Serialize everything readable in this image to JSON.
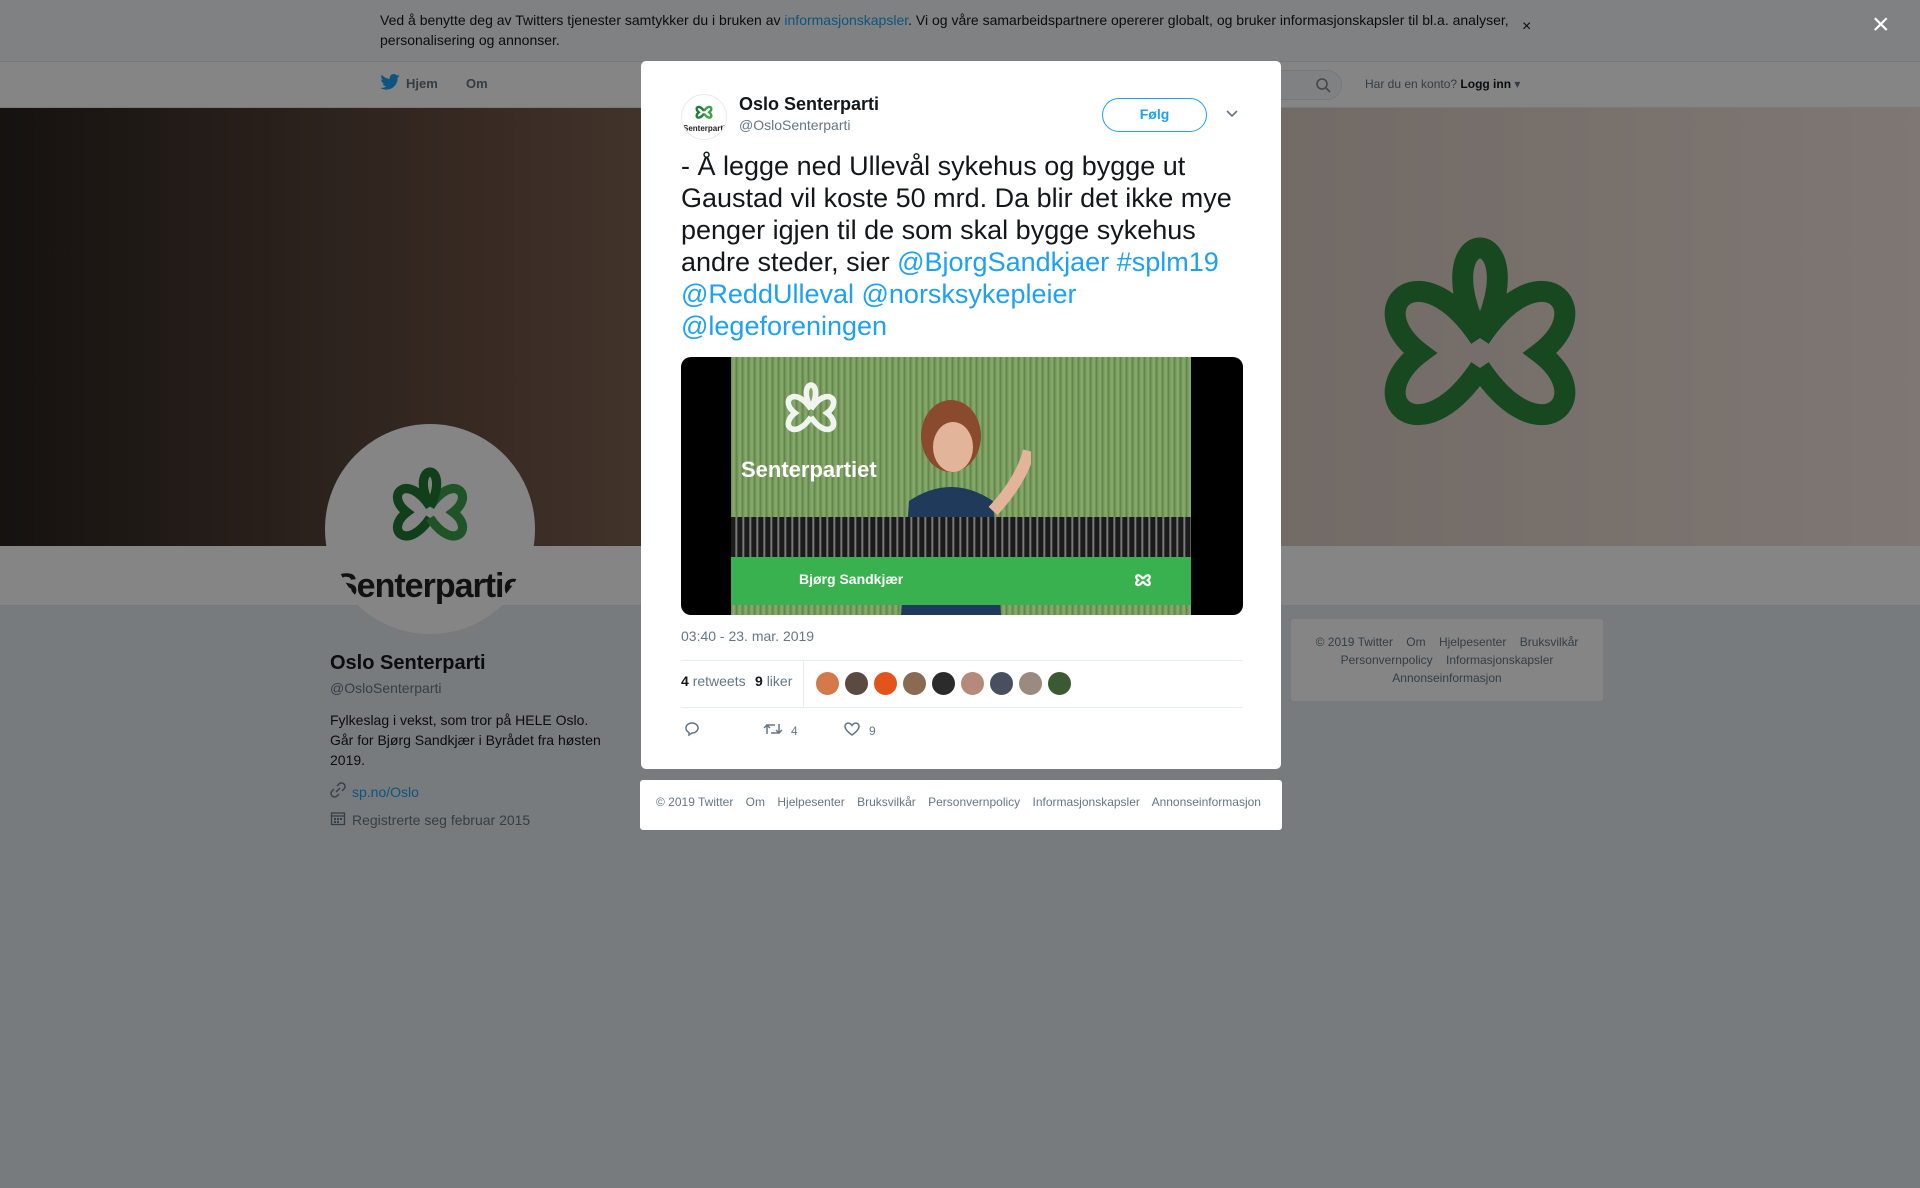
{
  "cookie_bar": {
    "text_before": "Ved å benytte deg av Twitters tjenester samtykker du i bruken av ",
    "link": "informasjonskapsler",
    "text_after": ". Vi og våre samarbeidspartnere opererer globalt, og bruker informasjonskapsler til bl.a. analyser, personalisering og annonser.",
    "close": "×"
  },
  "topnav": {
    "home": "Hjem",
    "about": "Om",
    "login_prompt": "Har du en konto?",
    "login": "Logg inn"
  },
  "overlay_close": "×",
  "profile": {
    "name": "Oslo Senterparti",
    "handle": "@OsloSenterparti",
    "bio": "Fylkeslag i vekst, som tror på HELE Oslo. Går for Bjørg Sandkjær i Byrådet fra høsten 2019.",
    "url": "sp.no/Oslo",
    "joined": "Registrerte seg februar 2015",
    "avatar_word": "Senterpartie",
    "brand_color": "#1f8b3a"
  },
  "side_footer": [
    "© 2019 Twitter",
    "Om",
    "Hjelpesenter",
    "Bruksvilkår",
    "Personvernpolicy",
    "Informasjonskapsler",
    "Annonseinformasjon"
  ],
  "tweet": {
    "name": "Oslo Senterparti",
    "handle": "@OsloSenterparti",
    "follow": "Følg",
    "text_plain": "- Å legge ned Ullevål sykehus og bygge ut Gaustad vil koste 50 mrd. Da blir det ikke mye penger igjen til de som skal bygge sykehus andre steder, sier ",
    "mentions": [
      "@BjorgSandkjaer",
      "#splm19",
      "@ReddUlleval",
      "@norsksykepleier",
      "@legeforeningen"
    ],
    "media": {
      "stage_word": "Senterpartiet",
      "caption": "Bjørg Sandkjær"
    },
    "timestamp": "03:40 - 23. mar. 2019",
    "retweets_count": "4",
    "retweets_label": "retweets",
    "likes_count": "9",
    "likes_label": "liker",
    "liker_colors": [
      "#d4794a",
      "#5a4a42",
      "#e2541c",
      "#8a6a50",
      "#2b2b2b",
      "#b58a7a",
      "#4a4f60",
      "#9a8a80",
      "#3c5a32"
    ],
    "action_retweets": "4",
    "action_likes": "9",
    "accent_color": "#1da1f2"
  },
  "modal_footer": [
    "© 2019 Twitter",
    "Om",
    "Hjelpesenter",
    "Bruksvilkår",
    "Personvernpolicy",
    "Informasjonskapsler",
    "Annonseinformasjon"
  ]
}
